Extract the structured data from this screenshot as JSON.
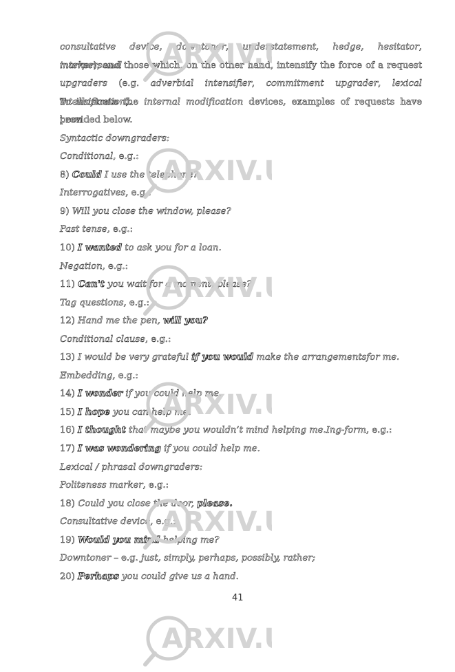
{
  "document": {
    "paragraph_lines": [
      [
        {
          "t": "consultative device",
          "i": true
        },
        {
          "t": ", "
        },
        {
          "t": "downtoner",
          "i": true
        },
        {
          "t": ", "
        },
        {
          "t": "understatement",
          "i": true
        },
        {
          "t": ", "
        },
        {
          "t": "hedge",
          "i": true
        },
        {
          "t": ", "
        },
        {
          "t": "hesitator",
          "i": true
        },
        {
          "t": ", "
        },
        {
          "t": "interpersonal",
          "i": true
        }
      ],
      [
        {
          "t": "marker",
          "i": true
        },
        {
          "t": "), and those which, on the other hand, intensify the force of a request"
        }
      ],
      [
        {
          "t": "upgraders",
          "i": true
        },
        {
          "t": " (e.g. "
        },
        {
          "t": "adverbial intensifier",
          "i": true
        },
        {
          "t": ", "
        },
        {
          "t": "commitment upgrader",
          "i": true
        },
        {
          "t": ", "
        },
        {
          "t": "lexical intensification",
          "i": true
        },
        {
          "t": ")."
        }
      ],
      [
        {
          "t": "To illustrate the "
        },
        {
          "t": "internal modification",
          "i": true
        },
        {
          "t": " devices, examples of requests have been"
        }
      ],
      [
        {
          "t": "provided below."
        }
      ]
    ],
    "items": [
      [
        {
          "t": "Syntactic downgraders:",
          "i": true
        }
      ],
      [
        {
          "t": "Conditional",
          "i": true
        },
        {
          "t": ", e.g.:"
        }
      ],
      [
        {
          "t": "8) "
        },
        {
          "t": "Could",
          "i": true,
          "b": true
        },
        {
          "t": " I use the telephone?",
          "i": true
        }
      ],
      [
        {
          "t": "Interrogatives",
          "i": true
        },
        {
          "t": ", e.g.:"
        }
      ],
      [
        {
          "t": "9) "
        },
        {
          "t": "Will you close the window, please?",
          "i": true
        }
      ],
      [
        {
          "t": "Past tense",
          "i": true
        },
        {
          "t": ", e.g.:"
        }
      ],
      [
        {
          "t": "10) "
        },
        {
          "t": "I wanted",
          "i": true,
          "b": true
        },
        {
          "t": " to ask you for a loan.",
          "i": true
        }
      ],
      [
        {
          "t": "Negation",
          "i": true
        },
        {
          "t": ", e.g.:"
        }
      ],
      [
        {
          "t": "11) "
        },
        {
          "t": "Can't",
          "i": true,
          "b": true
        },
        {
          "t": " you wait for a moment, please?",
          "i": true
        }
      ],
      [
        {
          "t": "Tag questions",
          "i": true
        },
        {
          "t": ", e.g.:"
        }
      ],
      [
        {
          "t": "12) "
        },
        {
          "t": "Hand me the pen, ",
          "i": true
        },
        {
          "t": "will you?",
          "i": true,
          "b": true
        }
      ],
      [
        {
          "t": "Conditional clause",
          "i": true
        },
        {
          "t": ", e.g.:"
        }
      ],
      [
        {
          "t": "13) "
        },
        {
          "t": "I would be very grateful ",
          "i": true
        },
        {
          "t": "if you would",
          "i": true,
          "b": true
        },
        {
          "t": " make the arrangementsfor me.",
          "i": true
        }
      ],
      [
        {
          "t": "Embedding",
          "i": true
        },
        {
          "t": ", e.g.:"
        }
      ],
      [
        {
          "t": "14) "
        },
        {
          "t": "I wonder",
          "i": true,
          "b": true
        },
        {
          "t": " if you could help me.",
          "i": true
        }
      ],
      [
        {
          "t": "15) "
        },
        {
          "t": "I hope",
          "i": true,
          "b": true
        },
        {
          "t": " you can help me.",
          "i": true
        }
      ],
      [
        {
          "t": "16) "
        },
        {
          "t": "I thought",
          "i": true,
          "b": true
        },
        {
          "t": " that maybe you wouldn’t mind helping me.Ing-form",
          "i": true
        },
        {
          "t": ", e.g.:"
        }
      ],
      [
        {
          "t": "17) "
        },
        {
          "t": "I was wondering",
          "i": true,
          "b": true
        },
        {
          "t": " if you could help me.",
          "i": true
        }
      ],
      [
        {
          "t": "Lexical / phrasal downgraders:",
          "i": true
        }
      ],
      [
        {
          "t": "Politeness marker",
          "i": true
        },
        {
          "t": ", e.g.:"
        }
      ],
      [
        {
          "t": "18) "
        },
        {
          "t": "Could you close the door, ",
          "i": true
        },
        {
          "t": "please.",
          "i": true,
          "b": true
        }
      ],
      [
        {
          "t": "Consultative device",
          "i": true
        },
        {
          "t": ", e.g.:"
        }
      ],
      [
        {
          "t": "19) "
        },
        {
          "t": "Would you mind",
          "i": true,
          "b": true
        },
        {
          "t": " helping me?",
          "i": true
        }
      ],
      [
        {
          "t": "Downtoner",
          "i": true
        },
        {
          "t": " – e.g. "
        },
        {
          "t": "just, simply, perhaps, possibly, rather;",
          "i": true
        }
      ],
      [
        {
          "t": "20) "
        },
        {
          "t": "Perhaps",
          "i": true,
          "b": true
        },
        {
          "t": " you could give us a hand.",
          "i": true
        }
      ]
    ],
    "page_number": "41"
  },
  "watermark": {
    "text": "ARXIV.UZ",
    "icon": "magnifier-icon",
    "color": "#cfcfcf",
    "count": 6
  }
}
